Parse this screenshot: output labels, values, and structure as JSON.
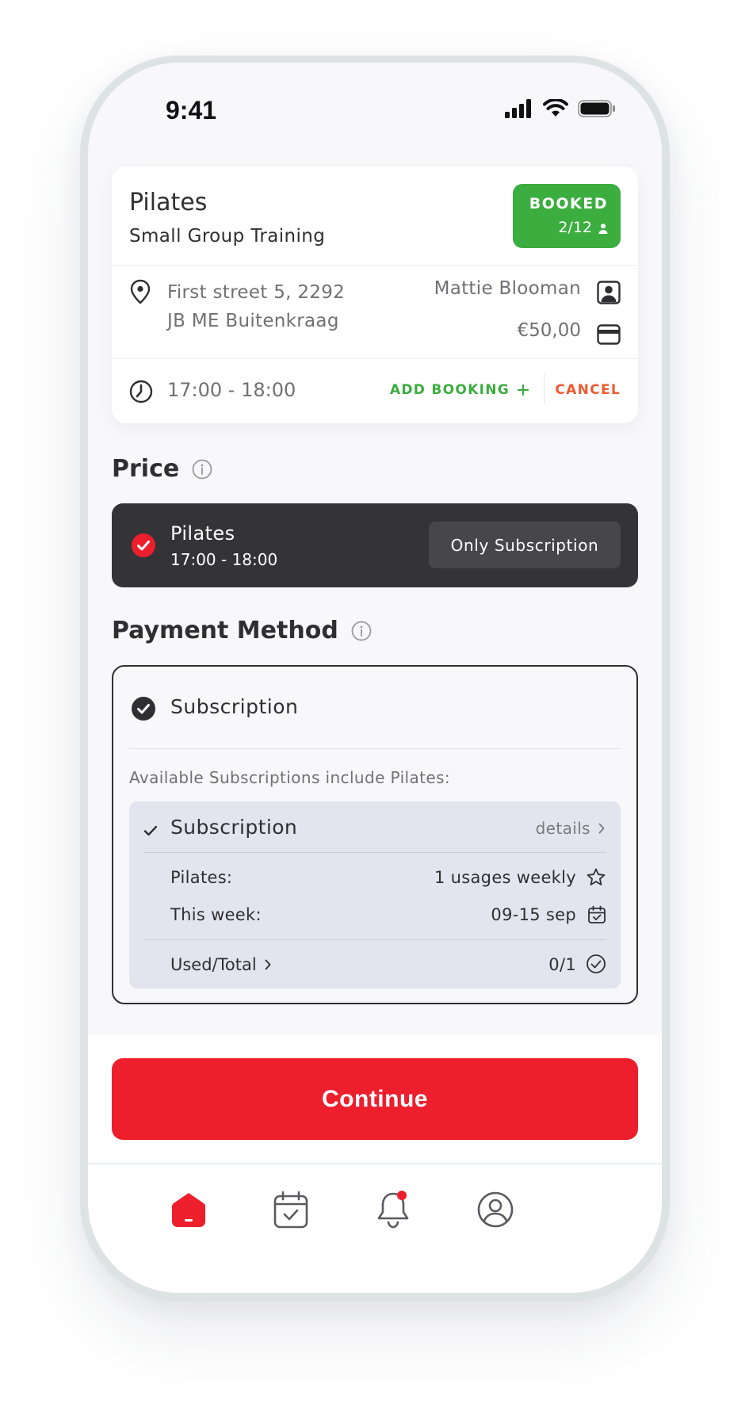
{
  "status_bar": {
    "time": "9:41"
  },
  "booking": {
    "title": "Pilates",
    "subtitle": "Small Group Training",
    "badge": {
      "label": "BOOKED",
      "count": "2/12"
    },
    "address_line1": "First street 5, 2292",
    "address_line2": "JB ME Buitenkraag",
    "trainer": "Mattie Blooman",
    "price": "€50,00",
    "time": "17:00 - 18:00",
    "add_booking_label": "ADD BOOKING",
    "cancel_label": "CANCEL"
  },
  "price_section": {
    "heading": "Price",
    "option": {
      "title": "Pilates",
      "time": "17:00 - 18:00",
      "tag": "Only Subscription"
    }
  },
  "payment_section": {
    "heading": "Payment Method",
    "method_label": "Subscription",
    "available_text": "Available Subscriptions include Pilates:",
    "subscription": {
      "title": "Subscription",
      "details_label": "details",
      "rows": [
        {
          "label": "Pilates:",
          "value": "1 usages weekly",
          "icon": "star-icon"
        },
        {
          "label": "This week:",
          "value": "09-15 sep",
          "icon": "calendar-icon"
        }
      ],
      "used_total_label": "Used/Total",
      "used_total_value": "0/1"
    }
  },
  "continue_label": "Continue",
  "nav": {
    "items": [
      {
        "name": "home",
        "active": true
      },
      {
        "name": "calendar",
        "active": false
      },
      {
        "name": "notifications",
        "active": false,
        "has_badge": true
      },
      {
        "name": "profile",
        "active": false
      }
    ]
  },
  "colors": {
    "accent_red": "#ee1f2d",
    "booked_green": "#3cad3f",
    "cancel_orange": "#ee5a31",
    "dark_option": "#343336"
  }
}
